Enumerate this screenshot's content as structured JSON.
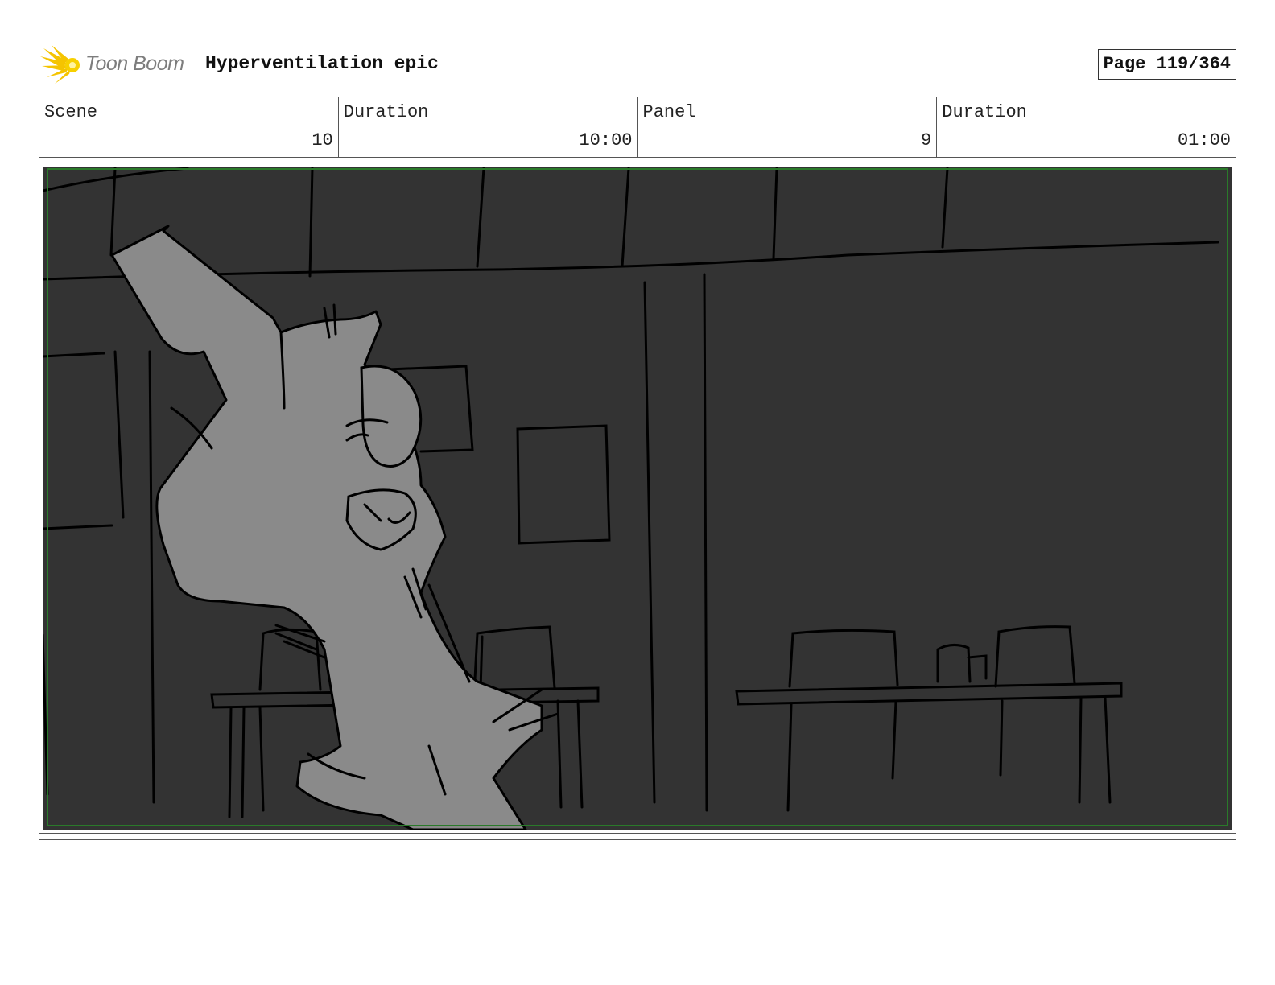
{
  "header": {
    "logo_text": "Toon Boom",
    "project_title": "Hyperventilation epic",
    "page_label": "Page 119/364"
  },
  "info": {
    "scene_label": "Scene",
    "scene_value": "10",
    "scene_duration_label": "Duration",
    "scene_duration_value": "10:00",
    "panel_label": "Panel",
    "panel_value": "9",
    "panel_duration_label": "Duration",
    "panel_duration_value": "01:00"
  },
  "panel": {
    "background_color": "#333333",
    "character_fill": "#8a8a8a",
    "line_color": "#000000",
    "safe_frame_color": "#2a7a2a"
  },
  "notes": {
    "text": ""
  },
  "colors": {
    "logo_star": "#f5c400",
    "logo_text": "#7d7d7d"
  }
}
